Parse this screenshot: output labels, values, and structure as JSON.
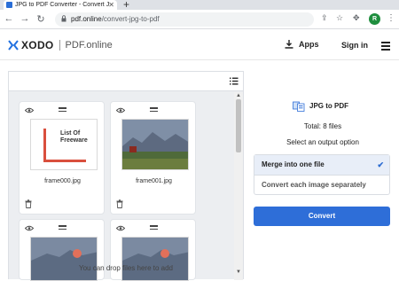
{
  "browser": {
    "tab_title": "JPG to PDF Converter - Convert J",
    "url_domain": "pdf.online",
    "url_path": "/convert-jpg-to-pdf",
    "profile_initial": "R"
  },
  "header": {
    "brand": "XODO",
    "sub_brand": "PDF.online",
    "apps_label": "Apps",
    "signin_label": "Sign in"
  },
  "files": [
    {
      "name": "frame000.jpg",
      "thumb_text": "List Of Freeware"
    },
    {
      "name": "frame001.jpg"
    }
  ],
  "drop_hint": "You can drop files here to add",
  "converter": {
    "title": "JPG to PDF",
    "total": "Total: 8 files",
    "option_prompt": "Select an output option",
    "options": [
      {
        "label": "Merge into one file",
        "selected": true
      },
      {
        "label": "Convert each image separately",
        "selected": false
      }
    ],
    "convert_label": "Convert"
  },
  "colors": {
    "accent": "#2e6ed8",
    "selected_bg": "#e8eef8"
  }
}
